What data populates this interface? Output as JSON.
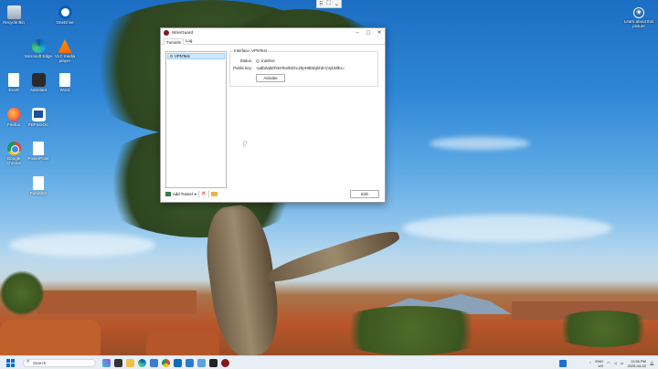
{
  "desktop": {
    "icons": [
      {
        "label": "Recycle Bin",
        "icon": "recycle-bin-icon"
      },
      {
        "label": "OneDrive",
        "icon": "onedrive-icon"
      },
      {
        "label": "Microsoft Edge",
        "icon": "edge-icon"
      },
      {
        "label": "VLC media player",
        "icon": "vlc-icon"
      },
      {
        "label": "Excel",
        "icon": "document-icon"
      },
      {
        "label": "Assistant",
        "icon": "app-icon"
      },
      {
        "label": "Word",
        "icon": "document-icon"
      },
      {
        "label": "Firefox",
        "icon": "firefox-icon"
      },
      {
        "label": "PDFtoDOC",
        "icon": "pdf-icon"
      },
      {
        "label": "Google Chrome",
        "icon": "chrome-icon"
      },
      {
        "label": "PowerPoint",
        "icon": "document-icon"
      },
      {
        "label": "Publisher",
        "icon": "document-icon"
      }
    ],
    "learn_label": "Learn about this picture"
  },
  "window": {
    "title": "WireGuard",
    "tabs": [
      "Tunnels",
      "Log"
    ],
    "tunnels": [
      {
        "name": "VPNTest"
      }
    ],
    "interface": {
      "legend": "Interface: VPNTest",
      "status_label": "Status:",
      "status_value": "Inactive",
      "pubkey_label": "Public key:",
      "pubkey_value": "+pdbZq8dTeEtTeel0Z/nczbpH8b5QkhD+jVybNfEc=",
      "activate_label": "Activate"
    },
    "add_tunnel_label": "Add Tunnel",
    "edit_label": "Edit"
  },
  "taskbar": {
    "search_placeholder": "Search",
    "lang_top": "ENG",
    "lang_bottom": "US",
    "time": "11:56 PM",
    "date": "2025-04-02"
  }
}
